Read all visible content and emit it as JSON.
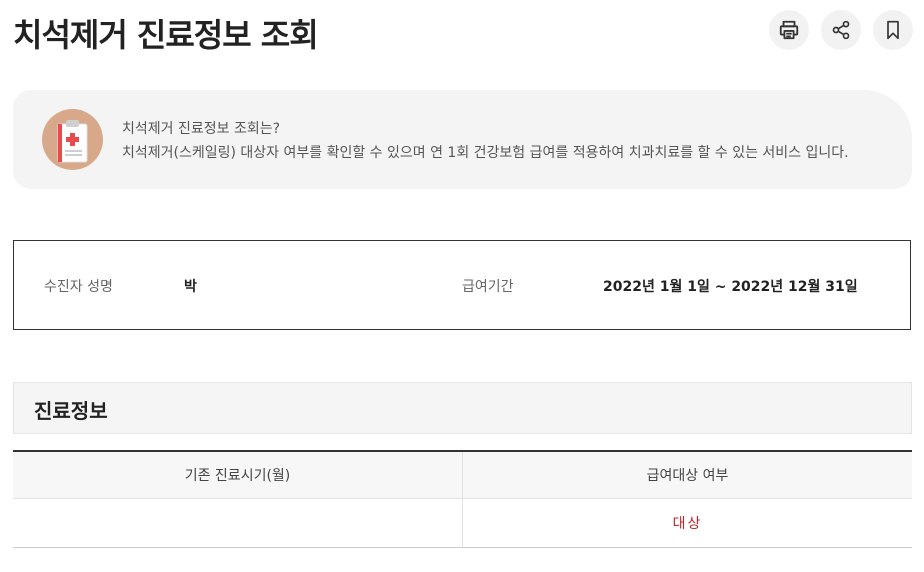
{
  "header": {
    "title": "치석제거 진료정보 조회",
    "actions": [
      {
        "icon": "printer-icon"
      },
      {
        "icon": "share-icon"
      },
      {
        "icon": "bookmark-icon"
      }
    ]
  },
  "info": {
    "icon": "clipboard-medical-icon",
    "question": "치석제거 진료정보 조회는?",
    "description": "치석제거(스케일링) 대상자 여부를 확인할 수 있으며 연 1회 건강보험 급여를 적용하여 치과치료를 할 수 있는 서비스 입니다."
  },
  "patient": {
    "name_label": "수진자 성명",
    "name_value": "박",
    "period_label": "급여기간",
    "period_value": "2022년 1월 1일 ~ 2022년 12월 31일"
  },
  "section": {
    "title": "진료정보"
  },
  "table": {
    "columns": [
      "기존 진료시기(월)",
      "급여대상 여부"
    ],
    "rows": [
      [
        "",
        "대상"
      ]
    ]
  },
  "colors": {
    "status_target": "#c0272d",
    "icon_circle": "#d7a98a"
  }
}
